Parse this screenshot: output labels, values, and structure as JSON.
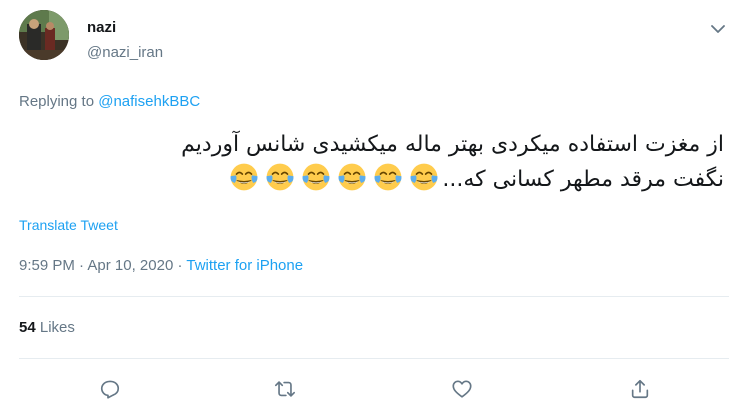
{
  "author": {
    "display_name": "nazi",
    "handle": "@nazi_iran"
  },
  "reply_context": {
    "prefix": "Replying to",
    "mention": "@nafisehkBBC"
  },
  "tweet": {
    "line1": "از مغزت استفاده میکردی بهتر ماله میکشیدی شانس آوردیم",
    "line2": "نگفت مرقد مطهر کسانی که...",
    "emoji_name": "face-with-tears-of-joy",
    "emoji_count": 6
  },
  "translate_label": "Translate Tweet",
  "meta": {
    "time": "9:59 PM",
    "separator1": " · ",
    "date": "Apr 10, 2020",
    "separator2": " · ",
    "source": "Twitter for iPhone"
  },
  "stats": {
    "likes_count": "54",
    "likes_label": "Likes"
  },
  "actions": {
    "reply_icon": "reply-icon",
    "retweet_icon": "retweet-icon",
    "like_icon": "heart-icon",
    "share_icon": "share-icon"
  },
  "colors": {
    "link": "#1da1f2",
    "secondary_text": "#657786",
    "divider": "#e6ecf0",
    "icon": "#657786"
  }
}
